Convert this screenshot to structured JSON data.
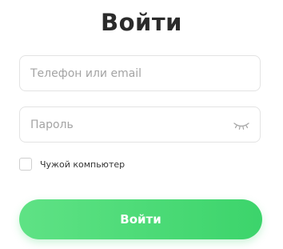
{
  "login_form": {
    "title": "Войти",
    "login_field": {
      "placeholder": "Телефон или email",
      "value": ""
    },
    "password_field": {
      "placeholder": "Пароль",
      "value": "",
      "toggle_icon": "eye-closed-icon"
    },
    "remember": {
      "label": "Чужой компьютер",
      "checked": false
    },
    "submit_label": "Войти"
  },
  "colors": {
    "title": "#2b2b2b",
    "button_start": "#5fe285",
    "button_end": "#3cd46b",
    "button_text": "#ffffff",
    "field_border": "#e3e3e3",
    "placeholder": "#a4a4a4"
  }
}
